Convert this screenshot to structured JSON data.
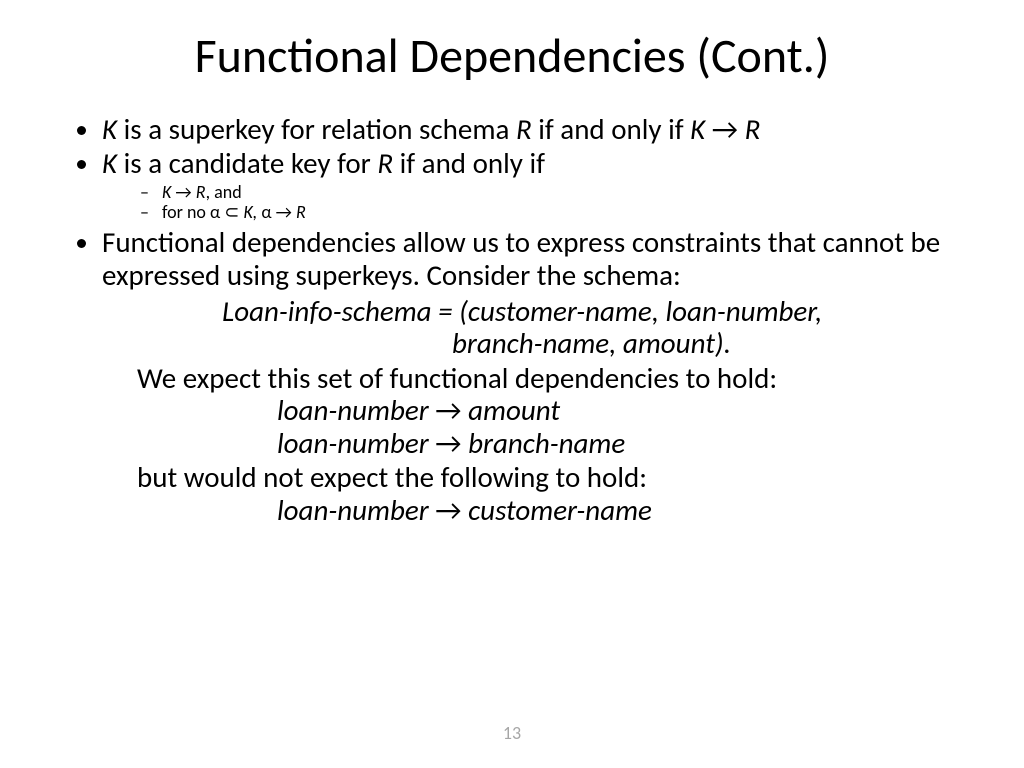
{
  "slide": {
    "title": "Functional Dependencies (Cont.)",
    "bullet1_pre": "K",
    "bullet1_mid": " is a superkey for relation schema ",
    "bullet1_R": "R",
    "bullet1_iff": " if and only if ",
    "bullet1_K2": "K ",
    "bullet1_arrow": "→",
    "bullet1_R2": " R",
    "bullet2_pre": "K",
    "bullet2_mid": " is a candidate key for ",
    "bullet2_R": "R",
    "bullet2_iff": " if and only if",
    "sub1_K": "K ",
    "sub1_arrow": "→",
    "sub1_R": " R",
    "sub1_and": ", and",
    "sub2_forno": "for no ",
    "sub2_alpha1": "α ",
    "sub2_subset": "⊂",
    "sub2_K": " K, ",
    "sub2_alpha2": "α ",
    "sub2_arrow": "→",
    "sub2_R": " R",
    "bullet3": "Functional dependencies allow us to express constraints that cannot be expressed using superkeys.  Consider the schema:",
    "schema1": "Loan-info-schema = (customer-name, loan-number,",
    "schema2": "branch-name, amount).",
    "expect": "We expect this set of functional dependencies to hold:",
    "fd1_left": "loan-number ",
    "fd1_arrow": "→",
    "fd1_right": " amount",
    "fd2_left": "loan-number ",
    "fd2_arrow": "→",
    "fd2_right": " branch-name",
    "notexpect": "but would not expect the following to hold:",
    "fd3_left": "loan-number ",
    "fd3_arrow": "→",
    "fd3_right": " customer-name",
    "page": "13"
  }
}
